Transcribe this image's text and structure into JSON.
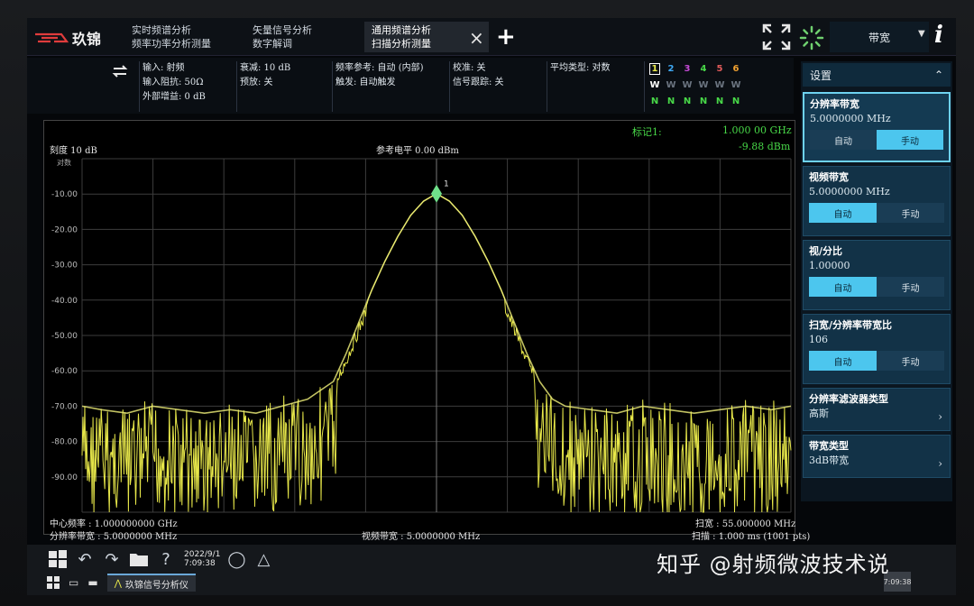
{
  "brand": {
    "name": "玖锦"
  },
  "tabs": [
    {
      "line1": "实时频谱分析",
      "line2": "频率功率分析测量"
    },
    {
      "line1": "矢量信号分析",
      "line2": "数字解调"
    },
    {
      "line1": "通用频谱分析",
      "line2": "扫描分析测量"
    }
  ],
  "header": {
    "close": "×",
    "add": "+",
    "bandwidth_menu": "带宽",
    "caret": "▼",
    "info": "i"
  },
  "params": {
    "input": "输入: 射频",
    "input_impedance": "输入阻抗:   50Ω",
    "ext_gain": "外部增益:   0 dB",
    "atten": "衰减:   10 dB",
    "preamp": "预放: 关",
    "freq_ref": "频率参考: 自动 (内部)",
    "trigger": "触发:   自动触发",
    "calibration": "校准: 关",
    "signal_track": "信号跟踪: 关",
    "avg_type": "平均类型: 对数"
  },
  "traces": {
    "numbers": [
      "1",
      "2",
      "3",
      "4",
      "5",
      "6"
    ],
    "modes": [
      "W",
      "W",
      "W",
      "W",
      "W",
      "W"
    ],
    "detectors": [
      "N",
      "N",
      "N",
      "N",
      "N",
      "N"
    ],
    "colors": [
      "#e8e84a",
      "#3fa9f5",
      "#c64bd6",
      "#48d848",
      "#e05a5a",
      "#f0a030"
    ]
  },
  "graph": {
    "scale": "刻度  10 dB",
    "log": "对数",
    "ref_level": "参考电平  0.00 dBm",
    "marker_label": "标记1:",
    "marker_freq": "1.000 00 GHz",
    "marker_amp": "-9.88 dBm",
    "marker_num": "1",
    "center_freq": "中心频率 : 1.000000000 GHz",
    "rbw": "分辨率带宽 : 5.0000000 MHz",
    "vbw": "视频带宽 : 5.0000000 MHz",
    "span": "扫宽 : 55.000000 MHz",
    "sweep": "扫描 : 1.000 ms (1001 pts)",
    "trace_color": "#e8e84a"
  },
  "chart_data": {
    "type": "line",
    "title": "",
    "xlabel": "",
    "ylabel": "",
    "x_range_mhz": [
      972.5,
      1027.5
    ],
    "y_range_db": [
      -100,
      0
    ],
    "yticks": [
      "-10.00",
      "-20.00",
      "-30.00",
      "-40.00",
      "-50.00",
      "-60.00",
      "-70.00",
      "-80.00",
      "-90.00"
    ],
    "grid": true,
    "series": [
      {
        "x": [
          972.5,
          974,
          976,
          978,
          980,
          982,
          984,
          986,
          988,
          990,
          992,
          993,
          994,
          995,
          996,
          997,
          998,
          999,
          1000,
          1001,
          1002,
          1003,
          1004,
          1005,
          1006,
          1007,
          1008,
          1009,
          1010,
          1012,
          1014,
          1016,
          1018,
          1020,
          1022,
          1024,
          1026,
          1027.5
        ],
        "y": [
          -70,
          -71,
          -72,
          -70,
          -71,
          -72,
          -71,
          -72,
          -70,
          -68,
          -63,
          -55,
          -46,
          -37,
          -29,
          -22,
          -16,
          -12,
          -9.88,
          -12,
          -16,
          -22,
          -29,
          -37,
          -46,
          -55,
          -63,
          -68,
          -70,
          -71,
          -72,
          -70,
          -71,
          -72,
          -71,
          -70,
          -71,
          -70
        ]
      }
    ]
  },
  "panel": {
    "title": "设置",
    "rbw": {
      "title": "分辨率带宽",
      "value": "5.0000000 MHz",
      "auto": "自动",
      "manual": "手动"
    },
    "vbw": {
      "title": "视频带宽",
      "value": "5.0000000 MHz",
      "auto": "自动",
      "manual": "手动"
    },
    "vbw_rbw": {
      "title": "视/分比",
      "value": "1.00000",
      "auto": "自动",
      "manual": "手动"
    },
    "span_rbw": {
      "title": "扫宽/分辨率带宽比",
      "value": "106",
      "auto": "自动",
      "manual": "手动"
    },
    "filter_type": {
      "title": "分辨率滤波器类型",
      "value": "高斯",
      "arrow": "›"
    },
    "bw_type": {
      "title": "带宽类型",
      "value": "3dB带宽",
      "arrow": "›"
    }
  },
  "taskbar": {
    "date": "2022/9/1",
    "time": "7:09:38",
    "app": "玖锦信号分析仪",
    "tray_time": "7:09:38"
  },
  "watermark": "知乎 @射频微波技术说"
}
